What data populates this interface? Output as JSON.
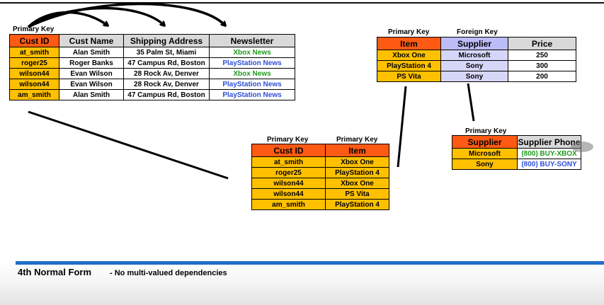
{
  "labels": {
    "primary_key": "Primary Key",
    "foreign_key": "Foreign Key"
  },
  "customers_table": {
    "headers": [
      "Cust ID",
      "Cust Name",
      "Shipping Address",
      "Newsletter"
    ],
    "rows": [
      [
        "at_smith",
        "Alan Smith",
        "35 Palm St, Miami",
        "Xbox News"
      ],
      [
        "roger25",
        "Roger Banks",
        "47 Campus Rd, Boston",
        "PlayStation News"
      ],
      [
        "wilson44",
        "Evan Wilson",
        "28 Rock Av, Denver",
        "Xbox News"
      ],
      [
        "wilson44",
        "Evan Wilson",
        "28 Rock Av, Denver",
        "PlayStation News"
      ],
      [
        "am_smith",
        "Alan Smith",
        "47 Campus Rd, Boston",
        "PlayStation News"
      ]
    ]
  },
  "items_table": {
    "headers": [
      "Item",
      "Supplier",
      "Price"
    ],
    "rows": [
      [
        "Xbox One",
        "Microsoft",
        "250"
      ],
      [
        "PlayStation 4",
        "Sony",
        "300"
      ],
      [
        "PS Vita",
        "Sony",
        "200"
      ]
    ]
  },
  "orders_table": {
    "headers": [
      "Cust ID",
      "Item"
    ],
    "rows": [
      [
        "at_smith",
        "Xbox One"
      ],
      [
        "roger25",
        "PlayStation 4"
      ],
      [
        "wilson44",
        "Xbox One"
      ],
      [
        "wilson44",
        "PS Vita"
      ],
      [
        "am_smith",
        "PlayStation 4"
      ]
    ]
  },
  "suppliers_table": {
    "headers": [
      "Supplier",
      "Supplier Phone"
    ],
    "rows": [
      [
        "Microsoft",
        "(800) BUY-XBOX"
      ],
      [
        "Sony",
        "(800) BUY-SONY"
      ]
    ]
  },
  "footer": {
    "title": "4th Normal Form",
    "description": "- No multi-valued dependencies"
  },
  "colors": {
    "primary_key_header": "#ff5a14",
    "primary_key_cell": "#ffc000",
    "foreign_key_header": "#bcbcf8",
    "foreign_key_cell": "#d6d6f8",
    "header_gray": "#d9d9d9",
    "newsletter_xbox": "#1f9a1f",
    "newsletter_playstation": "#2e4fd6",
    "accent_rule": "#1f6fc9"
  }
}
